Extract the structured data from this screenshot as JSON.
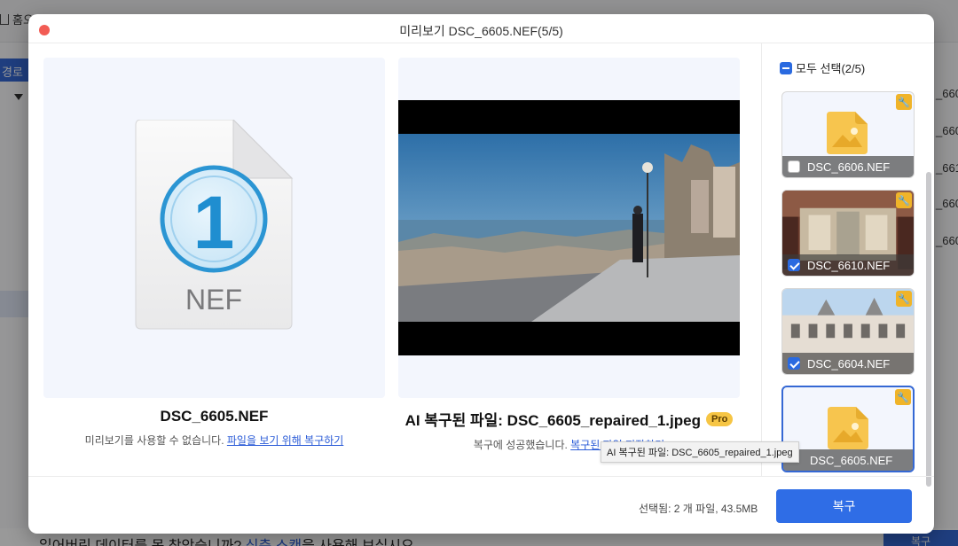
{
  "background": {
    "home_label": "홈오",
    "path_label": "경로",
    "right_items": [
      "_660",
      "_660",
      "_661",
      "_660",
      "_660"
    ],
    "bottom_text_prefix": "잃어버린 데이터를 못 찾았습니까? ",
    "bottom_text_link": "심층 스캔",
    "bottom_text_suffix": "을 사용해 보십시오.",
    "bottom_button": "복구"
  },
  "dialog": {
    "title": "미리보기 DSC_6605.NEF(5/5)",
    "left": {
      "icon_number": "1",
      "icon_ext": "NEF",
      "filename": "DSC_6605.NEF",
      "message": "미리보기를 사용할 수 없습니다.",
      "link": "파일을 보기 위해 복구하기"
    },
    "right": {
      "title": "AI 복구된 파일: DSC_6605_repaired_1.jpeg",
      "badge": "Pro",
      "message": "복구에 성공했습니다.",
      "link": "복구된 파일 저장하기",
      "tooltip": "AI 복구된 파일: DSC_6605_repaired_1.jpeg"
    },
    "sidebar": {
      "select_all": "모두 선택(2/5)",
      "thumbnails": [
        {
          "name": "DSC_6606.NEF",
          "checked": false
        },
        {
          "name": "DSC_6610.NEF",
          "checked": true
        },
        {
          "name": "DSC_6604.NEF",
          "checked": true
        },
        {
          "name": "DSC_6605.NEF",
          "checked": false
        }
      ]
    },
    "footer": {
      "summary": "선택됨: 2 개 파일, 43.5MB",
      "recover_button": "복구"
    }
  },
  "colors": {
    "accent": "#2f6de6",
    "pro_badge": "#f6c544",
    "close": "#f25c54"
  }
}
